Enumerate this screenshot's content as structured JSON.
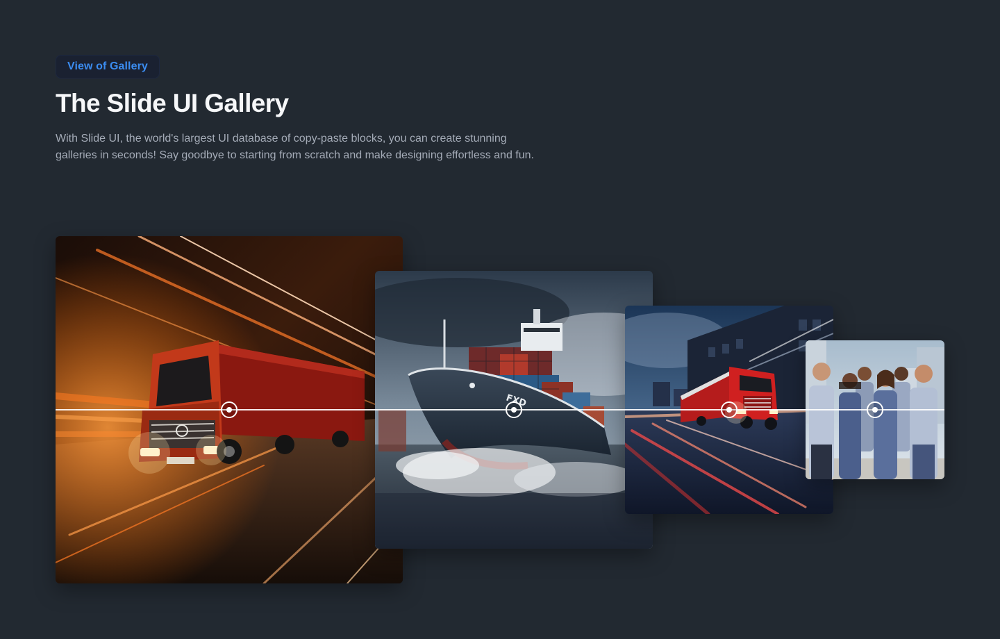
{
  "header": {
    "badge_label": "View of Gallery",
    "title": "The Slide UI Gallery",
    "description": "With Slide UI, the world's largest UI database of copy-paste blocks, you can create stunning galleries in seconds! Say goodbye to starting from scratch and make designing effortless and fun."
  },
  "gallery": {
    "images": [
      {
        "subject": "red semi-truck driving at night with orange light trails",
        "icon": "truck-image"
      },
      {
        "subject": "container cargo ship sailing through stormy waves",
        "icon": "ship-image",
        "hull_text": "FXD"
      },
      {
        "subject": "red truck speeding past city buildings at dusk",
        "icon": "city-truck-image"
      },
      {
        "subject": "smiling team of logistics workers in uniforms",
        "icon": "team-image"
      }
    ],
    "slider_icon": "slider-handle-icon"
  },
  "colors": {
    "background": "#222931",
    "accent": "#3b8cf0",
    "badge_bg": "#1a2131",
    "text_primary": "#f6f7f9",
    "text_secondary": "#a4abb7"
  }
}
